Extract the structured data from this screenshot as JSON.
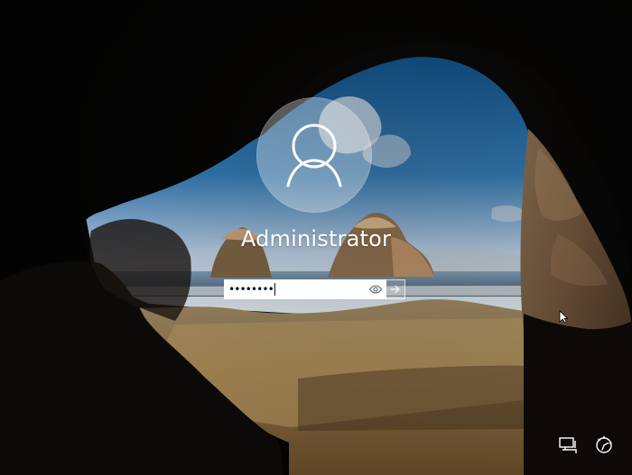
{
  "user": {
    "name": "Administrator"
  },
  "login": {
    "password_value": "••••••••"
  },
  "icons": {
    "avatar": "user-avatar-icon",
    "reveal_password": "eye-icon",
    "submit": "arrow-right-icon",
    "network": "network-icon",
    "ease_of_access": "ease-of-access-icon",
    "pointer": "mouse-pointer-icon"
  },
  "colors": {
    "text_primary": "#ffffff",
    "avatar_fill": "#ffffff55",
    "input_background": "#ffffff",
    "input_text": "#111111"
  }
}
